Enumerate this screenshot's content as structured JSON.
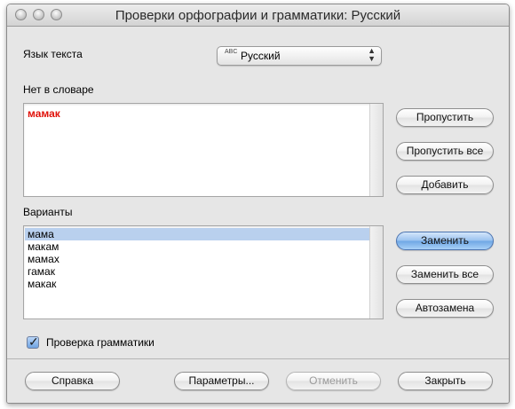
{
  "window": {
    "title": "Проверки орфографии и грамматики: Русский"
  },
  "language": {
    "label": "Язык текста",
    "selected": "Русский",
    "icon": "ABC"
  },
  "not_in_dictionary": {
    "label": "Нет в словаре",
    "word": "мамак"
  },
  "side_buttons": {
    "ignore": "Пропустить",
    "ignore_all": "Пропустить все",
    "add": "Добавить"
  },
  "suggestions": {
    "label": "Варианты",
    "items": [
      "мама",
      "макам",
      "мамах",
      "гамак",
      "макак"
    ],
    "selected_index": 0
  },
  "replace_buttons": {
    "replace": "Заменить",
    "replace_all": "Заменить все",
    "autocorrect": "Автозамена"
  },
  "grammar": {
    "label": "Проверка грамматики",
    "checked": true
  },
  "footer": {
    "help": "Справка",
    "options": "Параметры...",
    "undo": "Отменить",
    "close": "Закрыть"
  },
  "colors": {
    "misspelled": "#e0120a",
    "selection": "#b9d0ee",
    "default_button": "#6ea6e4"
  }
}
